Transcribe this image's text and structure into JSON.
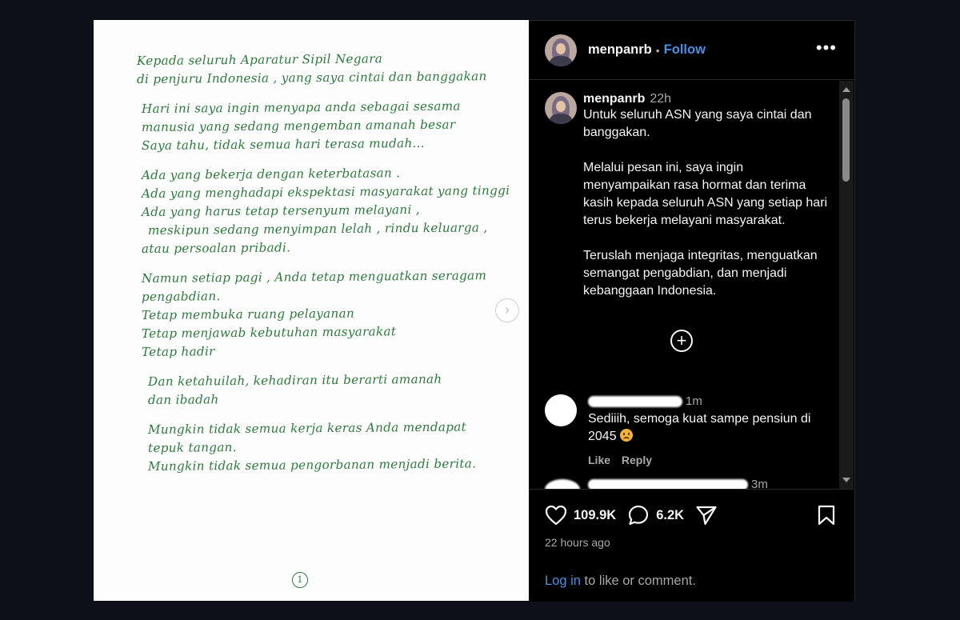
{
  "post": {
    "letter_lines": [
      "Kepada seluruh Aparatur Sipil Negara",
      "di penjuru Indonesia , yang saya cintai dan banggakan",
      "Hari ini saya ingin menyapa anda sebagai sesama",
      "manusia yang sedang mengemban amanah besar",
      "Saya tahu, tidak semua hari terasa mudah...",
      "Ada yang bekerja dengan keterbatasan .",
      "Ada yang menghadapi ekspektasi masyarakat yang tinggi",
      "Ada yang harus tetap tersenyum melayani ,",
      "meskipun sedang menyimpan lelah , rindu keluarga ,",
      "atau persoalan pribadi.",
      "Namun setiap pagi , Anda tetap menguatkan seragam",
      "pengabdian.",
      "Tetap membuka ruang pelayanan",
      "Tetap menjawab kebutuhan masyarakat",
      "Tetap hadir",
      "Dan ketahuilah, kehadiran itu berarti amanah",
      "dan ibadah",
      "Mungkin tidak semua kerja keras Anda mendapat",
      "tepuk tangan.",
      "Mungkin tidak semua pengorbanan menjadi berita."
    ],
    "page_number": "1",
    "next_arrow": "›"
  },
  "header": {
    "username": "menpanrb",
    "separator": "•",
    "follow_label": "Follow",
    "more_label": "•••"
  },
  "caption": {
    "username": "menpanrb",
    "time": "22h",
    "paragraph1": "Untuk seluruh ASN yang saya cintai dan banggakan.",
    "paragraph2": "Melalui pesan ini, saya ingin menyampaikan rasa hormat dan terima kasih kepada seluruh ASN yang setiap hari terus bekerja melayani masyarakat.",
    "paragraph3": "Teruslah menjaga integritas, menguatkan semangat pengabdian, dan menjadi kebanggaan Indonesia.",
    "load_more_icon": "⊕"
  },
  "comments": [
    {
      "time": "1m",
      "text": "Sediiih, semoga kuat sampe pensiun di 2045",
      "like_label": "Like",
      "reply_label": "Reply"
    },
    {
      "time": "3m"
    }
  ],
  "actions": {
    "likes": "109.9K",
    "comments": "6.2K",
    "posted": "22 hours ago",
    "login_link": "Log in",
    "login_rest": " to like or comment."
  },
  "icons": [
    "heart-icon",
    "comment-icon",
    "share-icon",
    "bookmark-icon",
    "more-icon",
    "plus-circle-icon",
    "chevron-right-icon"
  ],
  "colors": {
    "accent": "#4a90e2",
    "ink": "#2f7a3e",
    "panel": "#000000"
  }
}
